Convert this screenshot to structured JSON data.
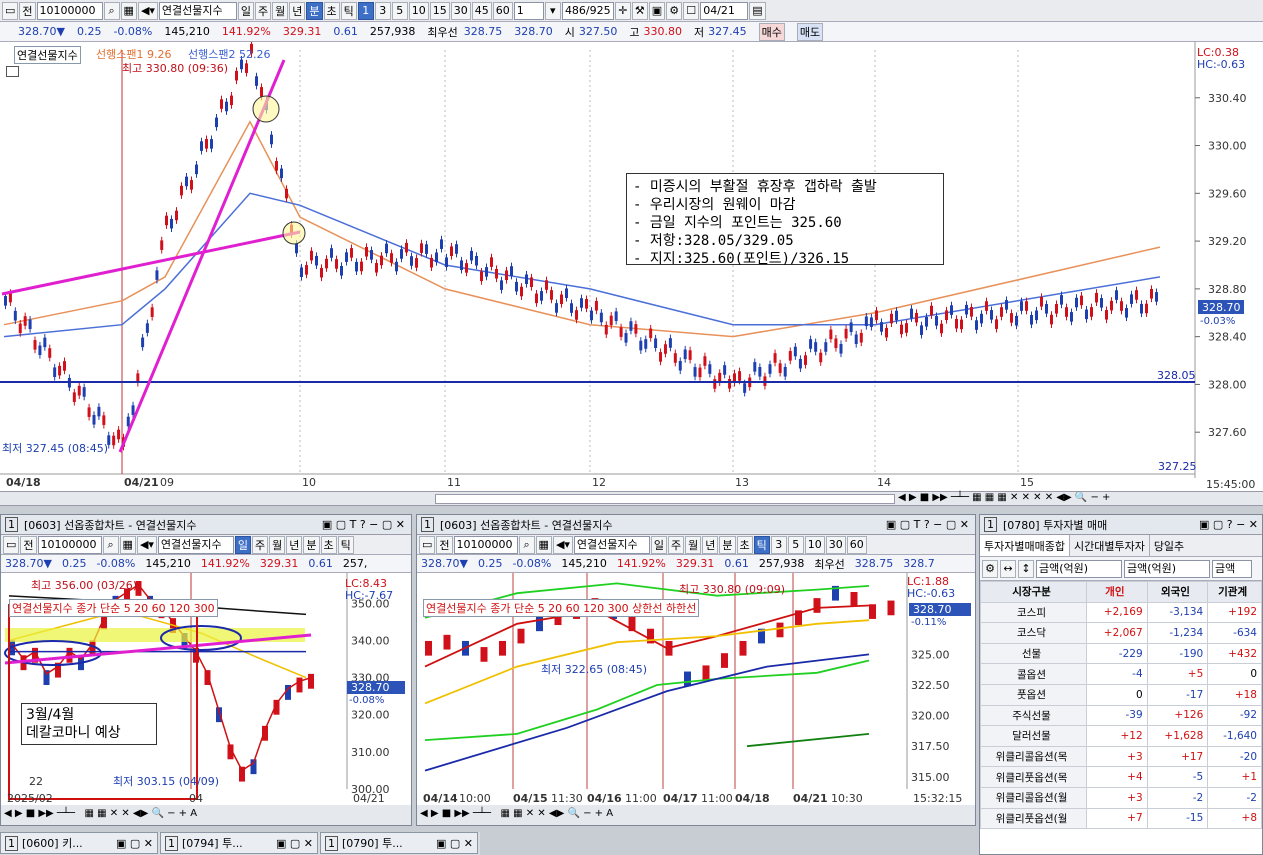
{
  "toolbar": {
    "code": "10100000",
    "name": "연결선물지수",
    "periods": [
      "일",
      "주",
      "월",
      "년",
      "분",
      "초",
      "틱"
    ],
    "active_period": "분",
    "intervals": [
      "1",
      "3",
      "5",
      "10",
      "15",
      "30",
      "45",
      "60"
    ],
    "interval_value": "1",
    "count": "486/925",
    "date": "04/21",
    "labels": {
      "prefix": "전"
    }
  },
  "quote": {
    "price": "328.70▼",
    "change": "0.25",
    "pct": "-0.08%",
    "volume": "145,210",
    "ratio": "141.92%",
    "prev": "329.31",
    "diff": "0.61",
    "oi": "257,938",
    "best_label": "최우선",
    "bid": "328.75",
    "ask": "328.70",
    "open_label": "시",
    "open": "327.50",
    "high_label": "고",
    "high": "330.80",
    "low_label": "저",
    "low": "327.45",
    "buy": "매수",
    "sell": "매도"
  },
  "main": {
    "legend": "연결선물지수",
    "legend2": "선행스팬1 9.26",
    "legend3": "선행스팬2 52.26",
    "lc": "LC:0.38",
    "hc": "HC:-0.63",
    "high_mark": "최고 330.80 (09:36)",
    "low_mark": "최저 327.45 (08:45)",
    "price_tag": "328.70",
    "pct_tag": "-0.03%",
    "line_label": "328.05",
    "bottom_label": "327.25",
    "time_label": "15:45:00",
    "y_ticks": [
      "330.40",
      "330.00",
      "329.60",
      "329.20",
      "328.80",
      "328.40",
      "328.00",
      "327.60"
    ],
    "x_labels": [
      "04/18",
      "04/21",
      "09",
      "10",
      "11",
      "12",
      "13",
      "14",
      "15"
    ],
    "annotation": [
      "- 미증시의 부활절 휴장후 갭하락 출발",
      "- 우리시장의 원웨이 마감",
      "- 금일 지수의 포인트는 325.60",
      "- 저항:328.05/329.05",
      "- 지지:325.60(포인트)/326.15"
    ]
  },
  "chart_data": {
    "type": "line",
    "title": "연결선물지수",
    "ylim": [
      327.25,
      330.8
    ],
    "support_line": 328.05,
    "x": [
      "04/18",
      "04/21 08:45",
      "09",
      "09:36",
      "10",
      "11",
      "12",
      "13",
      "14",
      "15"
    ],
    "series": [
      {
        "name": "연결선물지수",
        "values": [
          328.7,
          327.45,
          329.3,
          330.8,
          329.0,
          329.1,
          328.6,
          328.0,
          328.5,
          328.7
        ]
      },
      {
        "name": "선행스팬1",
        "values": [
          328.5,
          328.7,
          328.9,
          330.2,
          329.4,
          328.8,
          328.5,
          328.4,
          328.6,
          329.15
        ]
      },
      {
        "name": "선행스팬2",
        "values": [
          328.4,
          328.5,
          328.8,
          329.6,
          329.5,
          329.0,
          328.8,
          328.5,
          328.5,
          328.9
        ]
      }
    ]
  },
  "panel1": {
    "title": "[0603] 선옵종합차트 - 연결선물지수",
    "code": "10100000",
    "name": "연결선물지수",
    "quote": {
      "price": "328.70▼",
      "change": "0.25",
      "pct": "-0.08%",
      "volume": "145,210",
      "ratio": "141.92%",
      "prev": "329.31",
      "diff": "0.61",
      "oi": "257,"
    },
    "legend": "연결선물지수 종가 단순 5 20 60 120 300",
    "hi": "최고 356.00 (03/26)",
    "lo": "최저 303.15 (04/09)",
    "lc": "LC:8.43",
    "hc": "HC:-7.67",
    "tag": "328.70",
    "tagpct": "-0.08%",
    "note": [
      "3월/4월",
      "데칼코마니 예상"
    ],
    "small": "22",
    "x": [
      "2025/02",
      "04",
      "04/21"
    ],
    "y": [
      "350.00",
      "340.00",
      "330.00",
      "320.00",
      "310.00",
      "300.00"
    ]
  },
  "panel2": {
    "title": "[0603] 선옵종합차트 - 연결선물지수",
    "code": "10100000",
    "name": "연결선물지수",
    "quote": {
      "price": "328.70▼",
      "change": "0.25",
      "pct": "-0.08%",
      "volume": "145,210",
      "ratio": "141.92%",
      "prev": "329.31",
      "diff": "0.61",
      "oi": "257,938",
      "best": "최우선",
      "bid": "328.75",
      "ask": "328.7"
    },
    "legend": "연결선물지수 종가 단순 5 20 60 120 300 상한선 하한선",
    "hi": "최고 330.80 (09:09)",
    "lo": "최저 322.65 (08:45)",
    "lc": "LC:1.88",
    "hc": "HC:-0.63",
    "tag": "328.70",
    "tagpct": "-0.11%",
    "x": [
      "04/14",
      "10:00",
      "04/15",
      "11:30",
      "04/16",
      "11:00",
      "04/17",
      "11:00",
      "04/18",
      "04/21",
      "10:30",
      "15:32:15"
    ],
    "y": [
      "325.00",
      "322.50",
      "320.00",
      "317.50",
      "315.00"
    ]
  },
  "panel3": {
    "title": "[0780] 투자자별 매매",
    "tabs": [
      "투자자별매매종합",
      "시간대별투자자",
      "당일추"
    ],
    "filter1": "금액(억원)",
    "filter2": "금액(억원)",
    "filter3": "금액",
    "headers": [
      "시장구분",
      "개인",
      "외국인",
      "기관계"
    ],
    "rows": [
      [
        "코스피",
        "+2,169",
        "-3,134",
        "+192"
      ],
      [
        "코스닥",
        "+2,067",
        "-1,234",
        "-634"
      ],
      [
        "선물",
        "-229",
        "-190",
        "+432"
      ],
      [
        "콜옵션",
        "-4",
        "+5",
        "0"
      ],
      [
        "풋옵션",
        "0",
        "-17",
        "+18"
      ],
      [
        "주식선물",
        "-39",
        "+126",
        "-92"
      ],
      [
        "달러선물",
        "+12",
        "+1,628",
        "-1,640"
      ],
      [
        "위클리콜옵션(목",
        "+3",
        "+17",
        "-20"
      ],
      [
        "위클리풋옵션(목",
        "+4",
        "-5",
        "+1"
      ],
      [
        "위클리콜옵션(월",
        "+3",
        "-2",
        "-2"
      ],
      [
        "위클리풋옵션(월",
        "+7",
        "-15",
        "+8"
      ]
    ]
  },
  "taskbar": [
    "[0600] 키...",
    "[0794] 투...",
    "[0790] 투..."
  ],
  "colors": {
    "up": "#d0101a",
    "down": "#1e3fb0",
    "span1": "#e8915a",
    "span2": "#4a6fd8",
    "trend": "#e020d0"
  }
}
